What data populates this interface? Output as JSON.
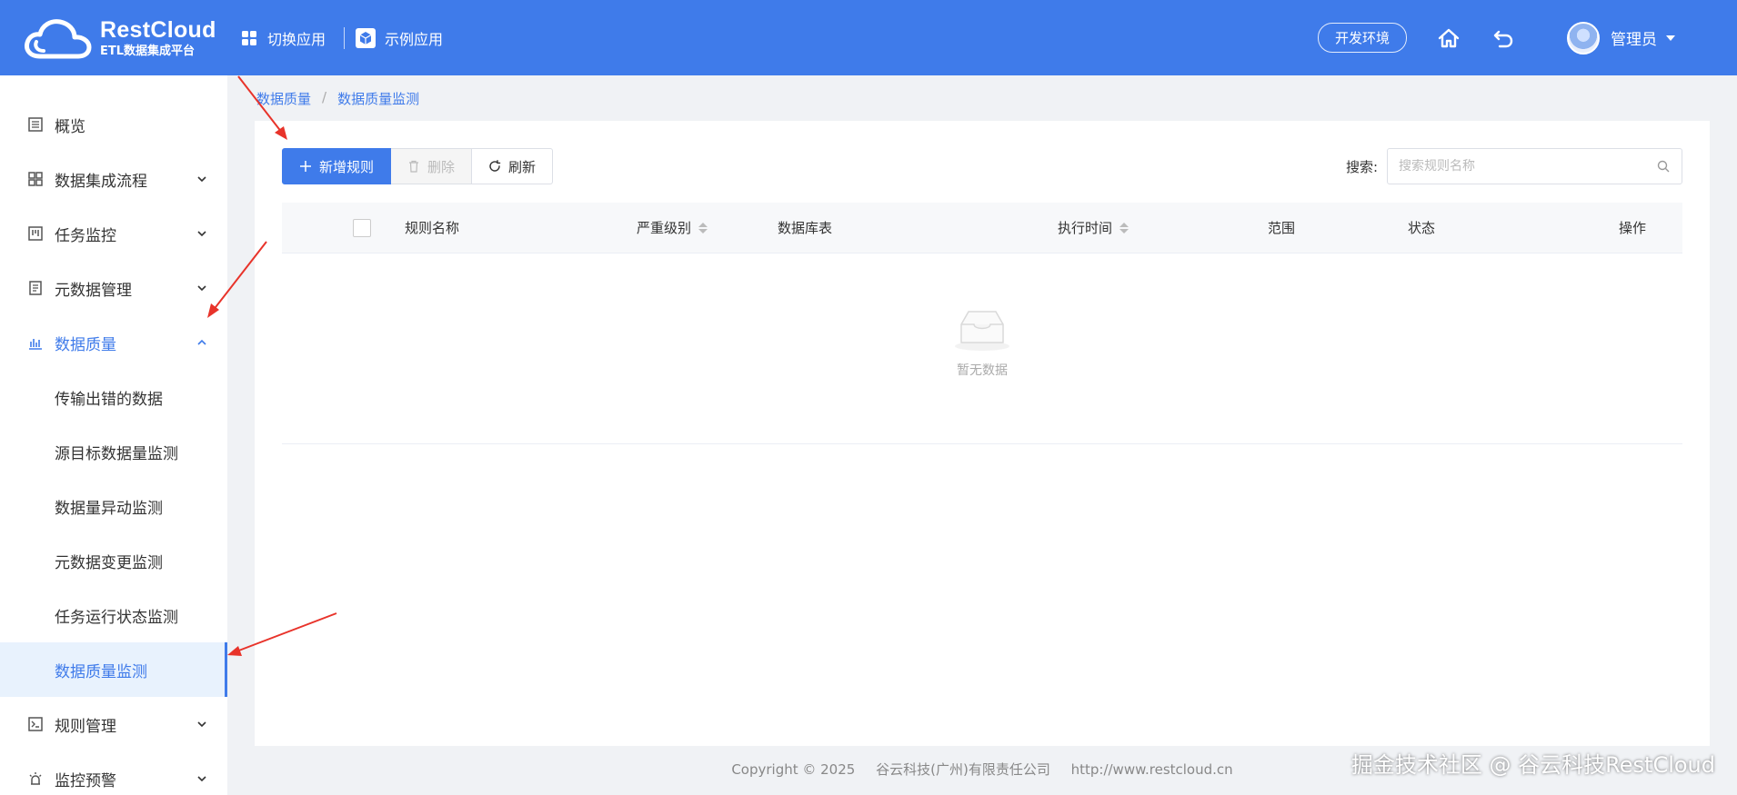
{
  "header": {
    "logo_title": "RestCloud",
    "logo_subtitle": "ETL数据集成平台",
    "switch_app": "切换应用",
    "sample_app": "示例应用",
    "env": "开发环境",
    "user_name": "管理员"
  },
  "sidebar": {
    "overview": "概览",
    "data_integration": "数据集成流程",
    "task_monitor": "任务监控",
    "metadata": "元数据管理",
    "data_quality": "数据质量",
    "sub": {
      "error_data": "传输出错的数据",
      "src_target": "源目标数据量监测",
      "volume_anomaly": "数据量异动监测",
      "meta_change": "元数据变更监测",
      "task_status": "任务运行状态监测",
      "dq_monitor": "数据质量监测"
    },
    "rule_mgmt": "规则管理",
    "alert": "监控预警"
  },
  "breadcrumb": {
    "parent": "数据质量",
    "sep": "/",
    "current": "数据质量监测"
  },
  "toolbar": {
    "add": "新增规则",
    "delete": "删除",
    "refresh": "刷新"
  },
  "search": {
    "label": "搜索:",
    "placeholder": "搜索规则名称"
  },
  "table": {
    "col_name": "规则名称",
    "col_severity": "严重级别",
    "col_db_table": "数据库表",
    "col_exec_time": "执行时间",
    "col_scope": "范围",
    "col_status": "状态",
    "col_action": "操作",
    "empty": "暂无数据"
  },
  "footer": {
    "copyright": "Copyright © 2025",
    "company": "谷云科技(广州)有限责任公司",
    "url": "http://www.restcloud.cn"
  },
  "watermark": "掘金技术社区 @ 谷云科技RestCloud",
  "colors": {
    "primary": "#3f7bea",
    "annotation_arrow": "#e8332a"
  }
}
